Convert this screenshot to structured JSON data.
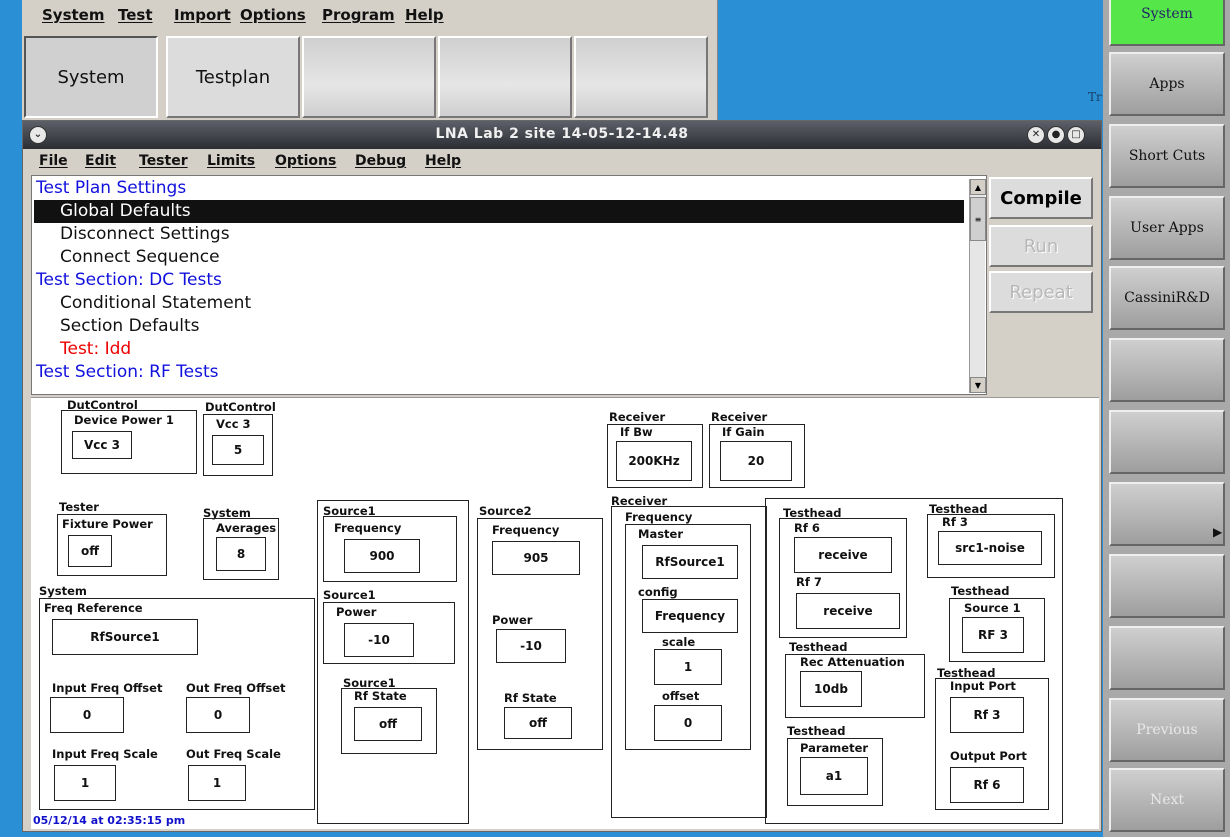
{
  "top_menu": [
    "System",
    "Test",
    "Import",
    "Options",
    "Program",
    "Help"
  ],
  "top_tabs": [
    "System",
    "Testplan",
    "",
    "",
    ""
  ],
  "bg_text": "Tr",
  "sidebar": [
    "System",
    "Apps",
    "Short Cuts",
    "User Apps",
    "CassiniR&D",
    "",
    "",
    "",
    "",
    "",
    "Previous",
    "Next"
  ],
  "window": {
    "title": "LNA Lab 2  site  14-05-12-14.48",
    "menu": [
      "File",
      "Edit",
      "Tester",
      "Limits",
      "Options",
      "Debug",
      "Help"
    ]
  },
  "tree": [
    {
      "text": "Test Plan Settings",
      "kind": "h"
    },
    {
      "text": "Global Defaults",
      "kind": "sel"
    },
    {
      "text": "Disconnect Settings",
      "kind": "s"
    },
    {
      "text": "Connect Sequence",
      "kind": "s"
    },
    {
      "text": "Test Section: DC Tests",
      "kind": "h"
    },
    {
      "text": "Conditional Statement",
      "kind": "s"
    },
    {
      "text": "Section Defaults",
      "kind": "s"
    },
    {
      "text": "Test: Idd",
      "kind": "red"
    },
    {
      "text": "Test Section: RF Tests",
      "kind": "h"
    }
  ],
  "buttons": {
    "compile": "Compile",
    "run": "Run",
    "repeat": "Repeat"
  },
  "panel": {
    "dut1": {
      "group": "DutControl",
      "label": "Device Power 1",
      "value": "Vcc 3"
    },
    "dut2": {
      "group": "DutControl",
      "label": "Vcc 3",
      "value": "5"
    },
    "rx_ifbw": {
      "group": "Receiver",
      "label": "If Bw",
      "value": "200KHz"
    },
    "rx_ifgain": {
      "group": "Receiver",
      "label": "If Gain",
      "value": "20"
    },
    "tester": {
      "group": "Tester",
      "label": "Fixture Power",
      "value": "off"
    },
    "averages": {
      "group": "System",
      "label": "Averages",
      "value": "8"
    },
    "system": {
      "group": "System",
      "freq_ref_label": "Freq Reference",
      "freq_ref": "RfSource1",
      "in_off_label": "Input Freq Offset",
      "in_off": "0",
      "out_off_label": "Out Freq Offset",
      "out_off": "0",
      "in_scale_label": "Input Freq Scale",
      "in_scale": "1",
      "out_scale_label": "Out Freq Scale",
      "out_scale": "1"
    },
    "src1": {
      "group": "Source1",
      "freq_label": "Frequency",
      "freq": "900",
      "group2": "Source1",
      "power_label": "Power",
      "power": "-10",
      "group3": "Source1",
      "state_label": "Rf State",
      "state": "off"
    },
    "src2": {
      "group": "Source2",
      "freq_label": "Frequency",
      "freq": "905",
      "power_label": "Power",
      "power": "-10",
      "state_label": "Rf State",
      "state": "off"
    },
    "rx_freq": {
      "group": "Receiver",
      "label": "Frequency",
      "master_label": "Master",
      "master": "RfSource1",
      "config_label": "config",
      "config": "Frequency",
      "scale_label": "scale",
      "scale": "1",
      "offset_label": "offset",
      "offset": "0"
    },
    "th_a": {
      "group": "Testhead",
      "rf6_label": "Rf 6",
      "rf6": "receive",
      "rf7_label": "Rf 7",
      "rf7": "receive"
    },
    "th_rf3": {
      "group": "Testhead",
      "label": "Rf 3",
      "value": "src1-noise"
    },
    "th_src1": {
      "group": "Testhead",
      "label": "Source 1",
      "value": "RF 3"
    },
    "th_att": {
      "group": "Testhead",
      "label": "Rec Attenuation",
      "value": "10db"
    },
    "th_port": {
      "group": "Testhead",
      "in_label": "Input Port",
      "in": "Rf 3",
      "out_label": "Output Port",
      "out": "Rf 6"
    },
    "th_param": {
      "group": "Testhead",
      "label": "Parameter",
      "value": "a1"
    }
  },
  "timestamp": "05/12/14 at 02:35:15 pm"
}
